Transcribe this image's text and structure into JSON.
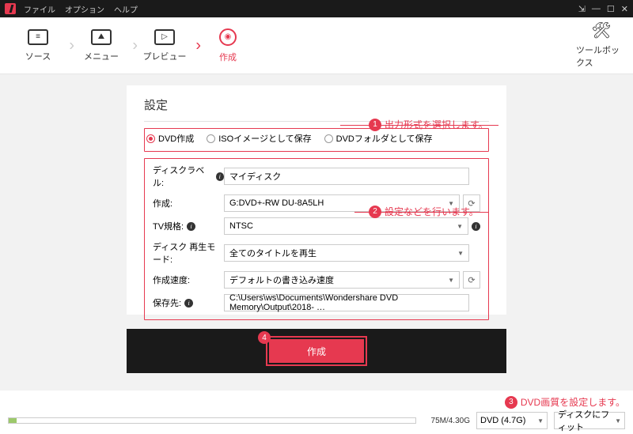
{
  "menu": {
    "file": "ファイル",
    "option": "オプション",
    "help": "ヘルプ"
  },
  "tabs": {
    "source": "ソース",
    "menu": "メニュー",
    "preview": "プレビュー",
    "create": "作成",
    "toolbox": "ツールボックス"
  },
  "panel": {
    "title": "設定",
    "radios": {
      "dvd": "DVD作成",
      "iso": "ISOイメージとして保存",
      "folder": "DVDフォルダとして保存"
    },
    "labels": {
      "disc_label": "ディスクラベル:",
      "create": "作成:",
      "tv": "TV規格:",
      "play_mode": "ディスク 再生モード:",
      "speed": "作成速度:",
      "save_to": "保存先:"
    },
    "values": {
      "disc_label": "マイディスク",
      "create": "G:DVD+-RW DU-8A5LH",
      "tv": "NTSC",
      "play_mode": "全てのタイトルを再生",
      "speed": "デフォルトの書き込み速度",
      "save_to": "C:\\Users\\ws\\Documents\\Wondershare DVD Memory\\Output\\2018- …"
    },
    "create_btn": "作成"
  },
  "footer": {
    "size": "75M/4.30G",
    "media": "DVD (4.7G)",
    "fit": "ディスクにフィット"
  },
  "annotations": {
    "a1": "出力形式を選択します。",
    "a2": "設定などを行います。",
    "a3": "DVD画質を設定します。",
    "n1": "1",
    "n2": "2",
    "n3": "3",
    "n4": "4"
  }
}
